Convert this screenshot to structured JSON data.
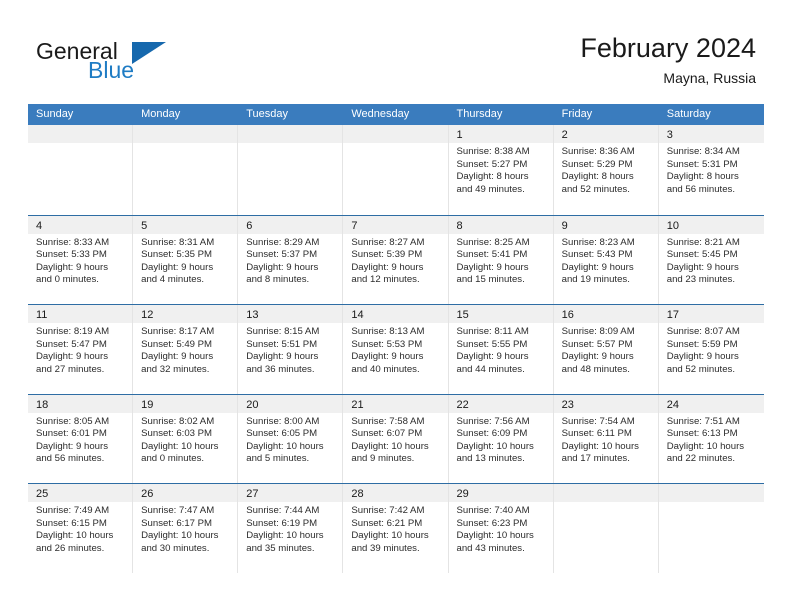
{
  "brand": {
    "name_part1": "General",
    "name_part2": "Blue",
    "logo_icon": "triangle-icon",
    "accent_color": "#1f7cc4"
  },
  "header": {
    "title": "February 2024",
    "subtitle": "Mayna, Russia"
  },
  "theme": {
    "header_blue": "#3a7cbe",
    "row_divider_blue": "#2e6da4",
    "daynum_strip_gray": "#f0f0f0",
    "column_divider": "#e4e4e4"
  },
  "weekdays": [
    "Sunday",
    "Monday",
    "Tuesday",
    "Wednesday",
    "Thursday",
    "Friday",
    "Saturday"
  ],
  "weeks": [
    [
      {
        "day": "",
        "lines": []
      },
      {
        "day": "",
        "lines": []
      },
      {
        "day": "",
        "lines": []
      },
      {
        "day": "",
        "lines": []
      },
      {
        "day": "1",
        "lines": [
          "Sunrise: 8:38 AM",
          "Sunset: 5:27 PM",
          "Daylight: 8 hours",
          "and 49 minutes."
        ]
      },
      {
        "day": "2",
        "lines": [
          "Sunrise: 8:36 AM",
          "Sunset: 5:29 PM",
          "Daylight: 8 hours",
          "and 52 minutes."
        ]
      },
      {
        "day": "3",
        "lines": [
          "Sunrise: 8:34 AM",
          "Sunset: 5:31 PM",
          "Daylight: 8 hours",
          "and 56 minutes."
        ]
      }
    ],
    [
      {
        "day": "4",
        "lines": [
          "Sunrise: 8:33 AM",
          "Sunset: 5:33 PM",
          "Daylight: 9 hours",
          "and 0 minutes."
        ]
      },
      {
        "day": "5",
        "lines": [
          "Sunrise: 8:31 AM",
          "Sunset: 5:35 PM",
          "Daylight: 9 hours",
          "and 4 minutes."
        ]
      },
      {
        "day": "6",
        "lines": [
          "Sunrise: 8:29 AM",
          "Sunset: 5:37 PM",
          "Daylight: 9 hours",
          "and 8 minutes."
        ]
      },
      {
        "day": "7",
        "lines": [
          "Sunrise: 8:27 AM",
          "Sunset: 5:39 PM",
          "Daylight: 9 hours",
          "and 12 minutes."
        ]
      },
      {
        "day": "8",
        "lines": [
          "Sunrise: 8:25 AM",
          "Sunset: 5:41 PM",
          "Daylight: 9 hours",
          "and 15 minutes."
        ]
      },
      {
        "day": "9",
        "lines": [
          "Sunrise: 8:23 AM",
          "Sunset: 5:43 PM",
          "Daylight: 9 hours",
          "and 19 minutes."
        ]
      },
      {
        "day": "10",
        "lines": [
          "Sunrise: 8:21 AM",
          "Sunset: 5:45 PM",
          "Daylight: 9 hours",
          "and 23 minutes."
        ]
      }
    ],
    [
      {
        "day": "11",
        "lines": [
          "Sunrise: 8:19 AM",
          "Sunset: 5:47 PM",
          "Daylight: 9 hours",
          "and 27 minutes."
        ]
      },
      {
        "day": "12",
        "lines": [
          "Sunrise: 8:17 AM",
          "Sunset: 5:49 PM",
          "Daylight: 9 hours",
          "and 32 minutes."
        ]
      },
      {
        "day": "13",
        "lines": [
          "Sunrise: 8:15 AM",
          "Sunset: 5:51 PM",
          "Daylight: 9 hours",
          "and 36 minutes."
        ]
      },
      {
        "day": "14",
        "lines": [
          "Sunrise: 8:13 AM",
          "Sunset: 5:53 PM",
          "Daylight: 9 hours",
          "and 40 minutes."
        ]
      },
      {
        "day": "15",
        "lines": [
          "Sunrise: 8:11 AM",
          "Sunset: 5:55 PM",
          "Daylight: 9 hours",
          "and 44 minutes."
        ]
      },
      {
        "day": "16",
        "lines": [
          "Sunrise: 8:09 AM",
          "Sunset: 5:57 PM",
          "Daylight: 9 hours",
          "and 48 minutes."
        ]
      },
      {
        "day": "17",
        "lines": [
          "Sunrise: 8:07 AM",
          "Sunset: 5:59 PM",
          "Daylight: 9 hours",
          "and 52 minutes."
        ]
      }
    ],
    [
      {
        "day": "18",
        "lines": [
          "Sunrise: 8:05 AM",
          "Sunset: 6:01 PM",
          "Daylight: 9 hours",
          "and 56 minutes."
        ]
      },
      {
        "day": "19",
        "lines": [
          "Sunrise: 8:02 AM",
          "Sunset: 6:03 PM",
          "Daylight: 10 hours",
          "and 0 minutes."
        ]
      },
      {
        "day": "20",
        "lines": [
          "Sunrise: 8:00 AM",
          "Sunset: 6:05 PM",
          "Daylight: 10 hours",
          "and 5 minutes."
        ]
      },
      {
        "day": "21",
        "lines": [
          "Sunrise: 7:58 AM",
          "Sunset: 6:07 PM",
          "Daylight: 10 hours",
          "and 9 minutes."
        ]
      },
      {
        "day": "22",
        "lines": [
          "Sunrise: 7:56 AM",
          "Sunset: 6:09 PM",
          "Daylight: 10 hours",
          "and 13 minutes."
        ]
      },
      {
        "day": "23",
        "lines": [
          "Sunrise: 7:54 AM",
          "Sunset: 6:11 PM",
          "Daylight: 10 hours",
          "and 17 minutes."
        ]
      },
      {
        "day": "24",
        "lines": [
          "Sunrise: 7:51 AM",
          "Sunset: 6:13 PM",
          "Daylight: 10 hours",
          "and 22 minutes."
        ]
      }
    ],
    [
      {
        "day": "25",
        "lines": [
          "Sunrise: 7:49 AM",
          "Sunset: 6:15 PM",
          "Daylight: 10 hours",
          "and 26 minutes."
        ]
      },
      {
        "day": "26",
        "lines": [
          "Sunrise: 7:47 AM",
          "Sunset: 6:17 PM",
          "Daylight: 10 hours",
          "and 30 minutes."
        ]
      },
      {
        "day": "27",
        "lines": [
          "Sunrise: 7:44 AM",
          "Sunset: 6:19 PM",
          "Daylight: 10 hours",
          "and 35 minutes."
        ]
      },
      {
        "day": "28",
        "lines": [
          "Sunrise: 7:42 AM",
          "Sunset: 6:21 PM",
          "Daylight: 10 hours",
          "and 39 minutes."
        ]
      },
      {
        "day": "29",
        "lines": [
          "Sunrise: 7:40 AM",
          "Sunset: 6:23 PM",
          "Daylight: 10 hours",
          "and 43 minutes."
        ]
      },
      {
        "day": "",
        "lines": []
      },
      {
        "day": "",
        "lines": []
      }
    ]
  ]
}
